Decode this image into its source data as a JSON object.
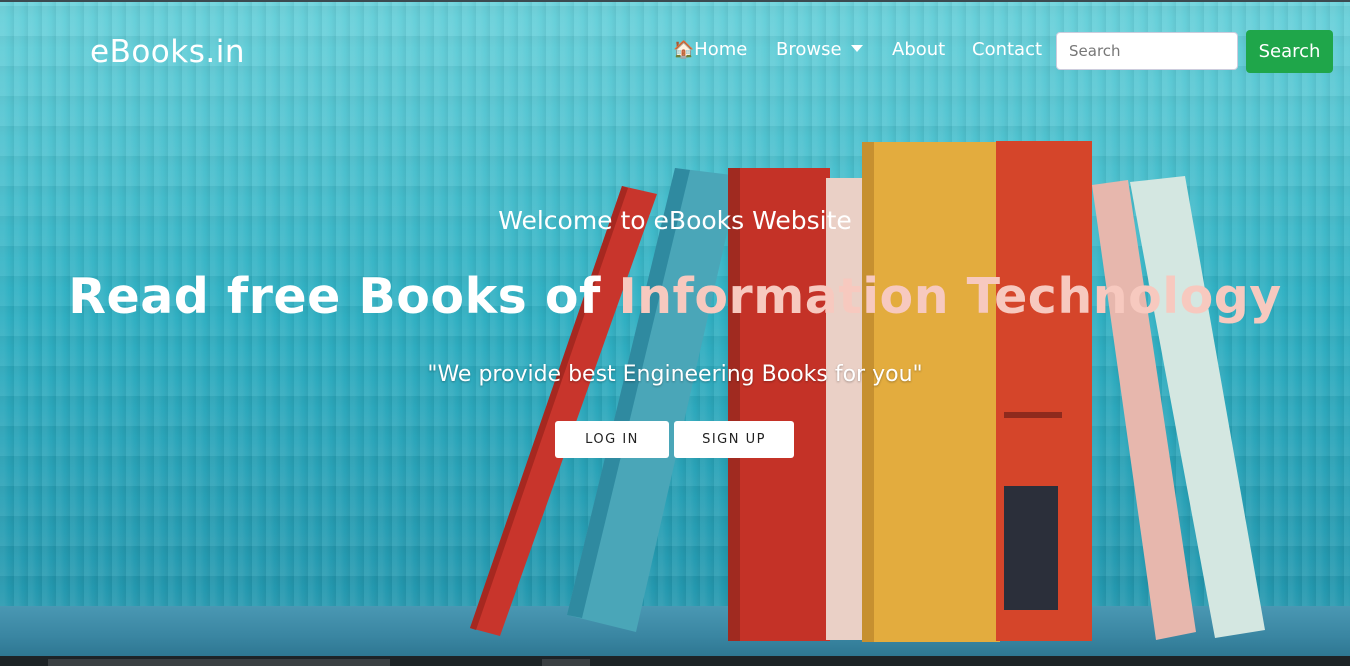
{
  "nav": {
    "brand": "eBooks.in",
    "home_label": "Home",
    "browse_label": "Browse",
    "about_label": "About",
    "contact_label": "Contact",
    "search_placeholder": "Search",
    "search_button": "Search"
  },
  "hero": {
    "welcome": "Welcome to eBooks Website",
    "headline_part1": "Read free Books of ",
    "headline_part2": "Information Technology",
    "tagline": "\"We provide best Engineering Books for you\"",
    "login_label": "LOG IN",
    "signup_label": "SIGN UP"
  },
  "colors": {
    "accent_headline": "#f7c9bf",
    "search_button": "#1fa64a",
    "background": "#2cb5c5"
  },
  "icons": {
    "home": "home-icon",
    "browse_caret": "chevron-down-icon"
  }
}
